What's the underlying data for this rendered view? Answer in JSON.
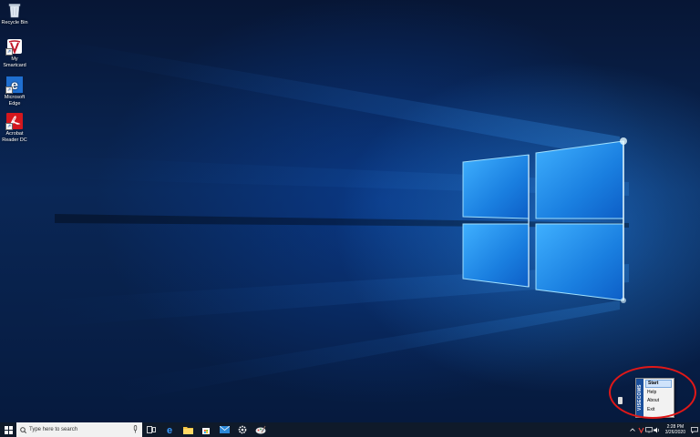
{
  "desktop": {
    "icons": [
      {
        "label": "Recycle Bin",
        "icon": "recycle-bin-icon"
      },
      {
        "label": "My\nSmartcard",
        "icon": "smartcard-app-icon"
      },
      {
        "label": "Microsoft\nEdge",
        "icon": "edge-icon"
      },
      {
        "label": "Acrobat\nReader DC",
        "icon": "acrobat-icon"
      }
    ]
  },
  "taskbar": {
    "search_placeholder": "Type here to search",
    "pinned": [
      "task-view-icon",
      "edge-icon",
      "file-explorer-icon",
      "store-icon",
      "mail-icon",
      "settings-icon",
      "paint-icon"
    ],
    "clock_time": "2:28 PM",
    "clock_date": "3/26/2020"
  },
  "context_menu": {
    "side_label": "VISECOMS",
    "items": [
      "Start",
      "Help",
      "About",
      "Exit"
    ],
    "highlighted": "Start"
  },
  "colors": {
    "accent_blue": "#1a78d8",
    "highlight_ring": "#e01818",
    "taskbar": "#0f1a2a"
  }
}
